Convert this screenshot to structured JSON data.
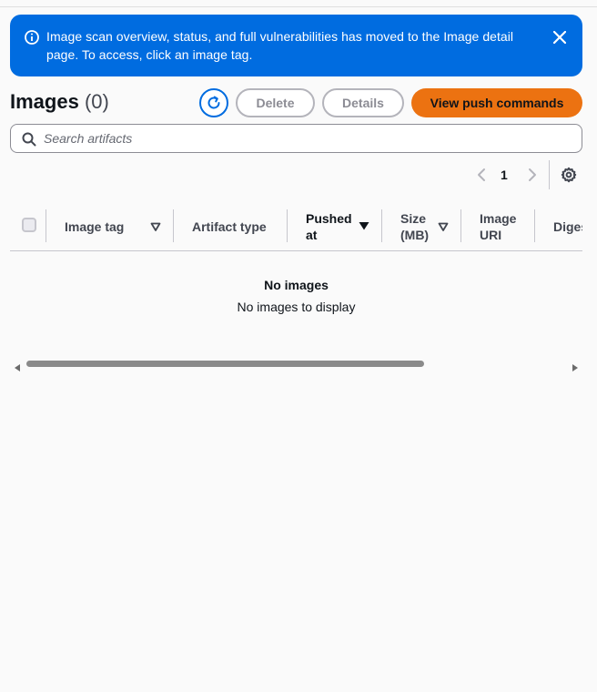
{
  "flash": {
    "message": "Image scan overview, status, and full vulnerabilities has moved to the Image detail page. To access, click an image tag.",
    "icon": "info-icon",
    "close_icon": "close-icon",
    "color": "#006ce0"
  },
  "header": {
    "title": "Images",
    "count": "(0)"
  },
  "actions": {
    "refresh_icon": "refresh-icon",
    "delete_label": "Delete",
    "details_label": "Details",
    "push_label": "View push commands",
    "primary_color": "#ec7211"
  },
  "search": {
    "placeholder": "Search artifacts",
    "value": ""
  },
  "pagination": {
    "current_page": "1"
  },
  "table": {
    "columns": {
      "image_tag": "Image tag",
      "artifact_type": "Artifact type",
      "pushed_at_line1": "Pushed",
      "pushed_at_line2": "at",
      "size_line1": "Size",
      "size_line2": "(MB)",
      "image_uri_line1": "Image",
      "image_uri_line2": "URI",
      "digest": "Digest"
    },
    "sorted_column": "Pushed at",
    "sort_direction": "descending",
    "rows": []
  },
  "empty": {
    "title": "No images",
    "subtitle": "No images to display"
  }
}
